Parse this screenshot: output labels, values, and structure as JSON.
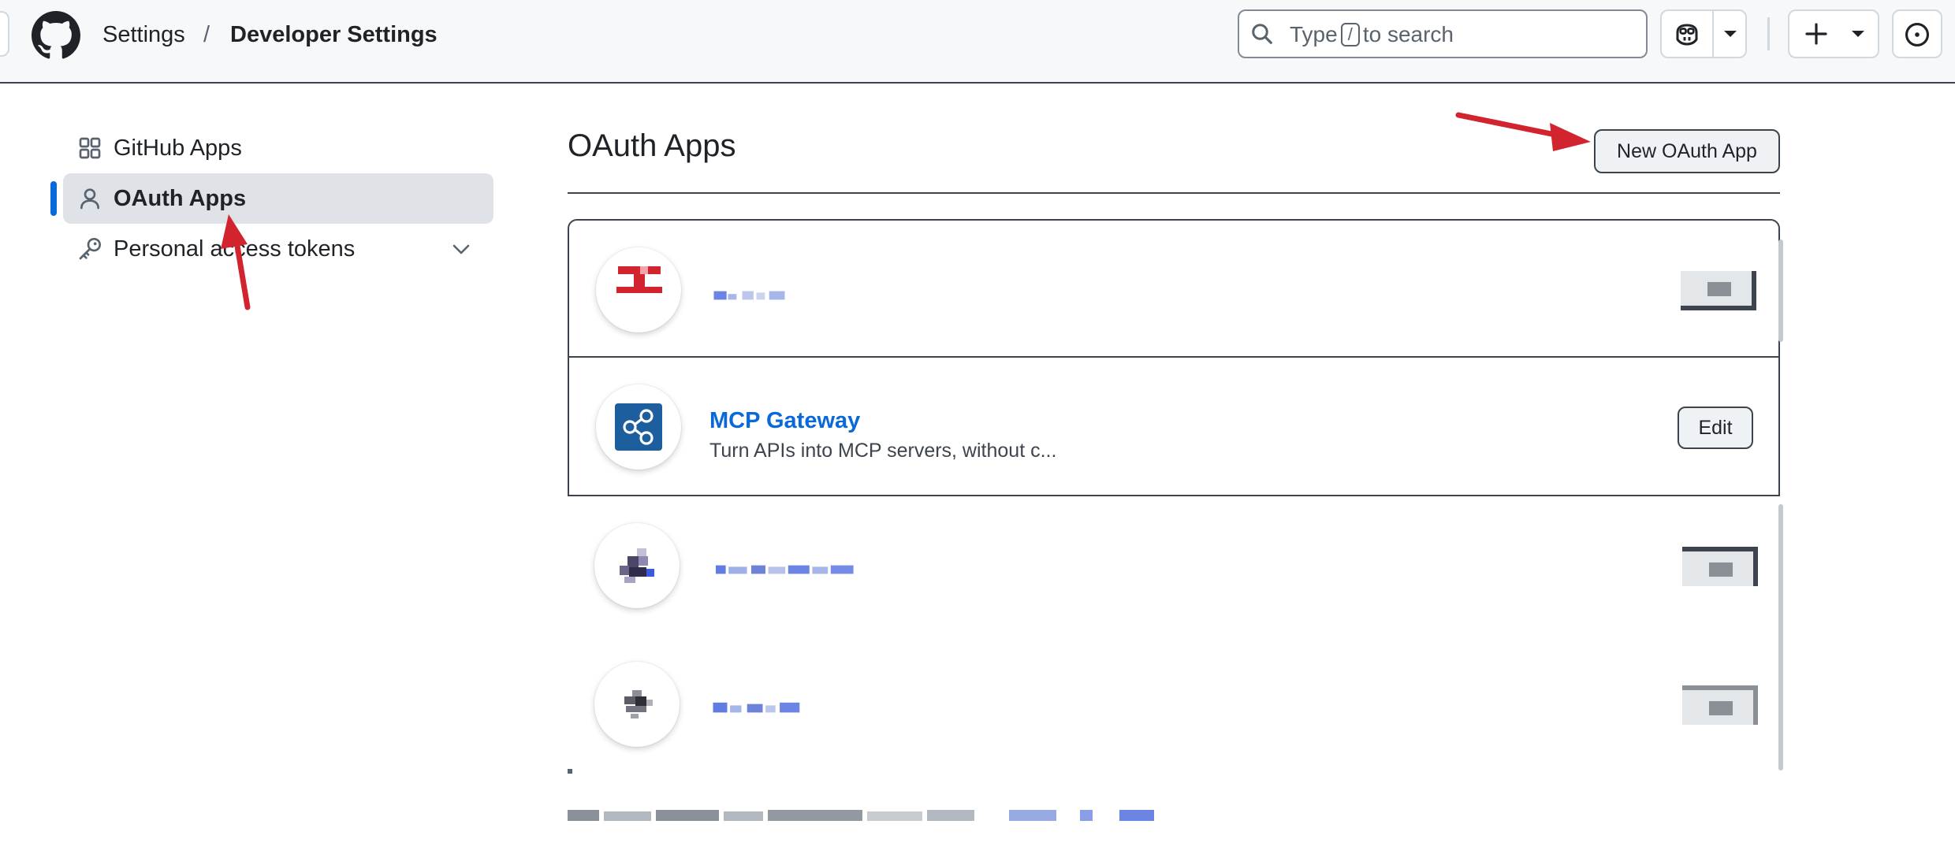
{
  "header": {
    "breadcrumb": [
      "Settings",
      "Developer Settings"
    ],
    "separator": "/",
    "search": {
      "prefix": "Type",
      "key": "/",
      "suffix": "to search"
    }
  },
  "sidebar": {
    "items": [
      {
        "label": "GitHub Apps",
        "icon": "apps-grid-icon"
      },
      {
        "label": "OAuth Apps",
        "icon": "person-icon",
        "active": true
      },
      {
        "label": "Personal access tokens",
        "icon": "key-icon",
        "expandable": true
      }
    ]
  },
  "main": {
    "title": "OAuth Apps",
    "new_button": "New OAuth App",
    "apps": [
      {
        "name": "",
        "description": "",
        "blurred": true
      },
      {
        "name": "MCP Gateway",
        "description": "Turn APIs into MCP servers, without c...",
        "edit_label": "Edit",
        "icon": "share-nodes-icon"
      },
      {
        "name": "",
        "description": "",
        "blurred": true
      },
      {
        "name": "",
        "description": "",
        "blurred": true
      }
    ]
  },
  "colors": {
    "link": "#0969da",
    "active_bar": "#0969da",
    "annotation": "#d1242f"
  }
}
